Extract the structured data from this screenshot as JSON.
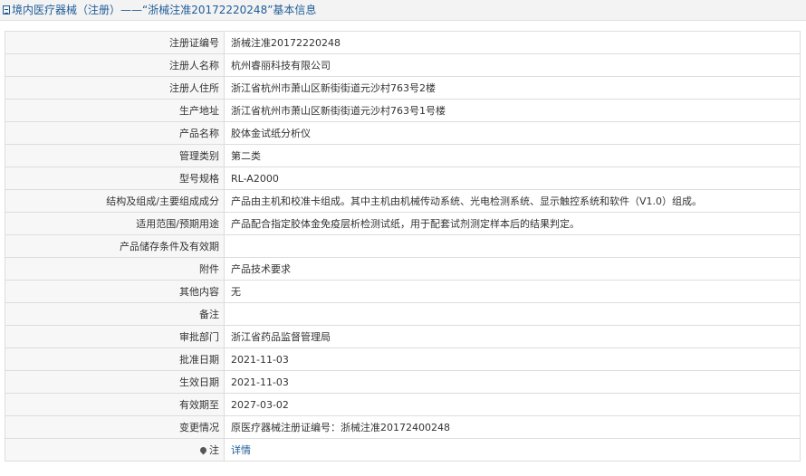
{
  "header": {
    "title": "境内医疗器械（注册）——“浙械注准20172220248”基本信息"
  },
  "rows": [
    {
      "label": "注册证编号",
      "value": "浙械注准20172220248"
    },
    {
      "label": "注册人名称",
      "value": "杭州睿丽科技有限公司"
    },
    {
      "label": "注册人住所",
      "value": "浙江省杭州市萧山区新街街道元沙村763号2楼"
    },
    {
      "label": "生产地址",
      "value": "浙江省杭州市萧山区新街街道元沙村763号1号楼"
    },
    {
      "label": "产品名称",
      "value": "胶体金试纸分析仪"
    },
    {
      "label": "管理类别",
      "value": "第二类"
    },
    {
      "label": "型号规格",
      "value": "RL-A2000"
    },
    {
      "label": "结构及组成/主要组成成分",
      "value": "产品由主机和校准卡组成。其中主机由机械传动系统、光电检测系统、显示触控系统和软件（V1.0）组成。"
    },
    {
      "label": "适用范围/预期用途",
      "value": "产品配合指定胶体金免疫层析检测试纸，用于配套试剂测定样本后的结果判定。"
    },
    {
      "label": "产品储存条件及有效期",
      "value": ""
    },
    {
      "label": "附件",
      "value": "产品技术要求"
    },
    {
      "label": "其他内容",
      "value": "无"
    },
    {
      "label": "备注",
      "value": ""
    },
    {
      "label": "审批部门",
      "value": "浙江省药品监督管理局"
    },
    {
      "label": "批准日期",
      "value": "2021-11-03"
    },
    {
      "label": "生效日期",
      "value": "2021-11-03"
    },
    {
      "label": "有效期至",
      "value": "2027-03-02"
    },
    {
      "label": "变更情况",
      "value": "原医疗器械注册证编号：浙械注准20172400248"
    }
  ],
  "note_row": {
    "label": "注",
    "icon": "pin-icon",
    "link_text": "详情"
  },
  "colors": {
    "header_text": "#1e5c97",
    "link": "#1e5c97",
    "label_bg": "#f7f7f7",
    "border": "#dddddd"
  }
}
